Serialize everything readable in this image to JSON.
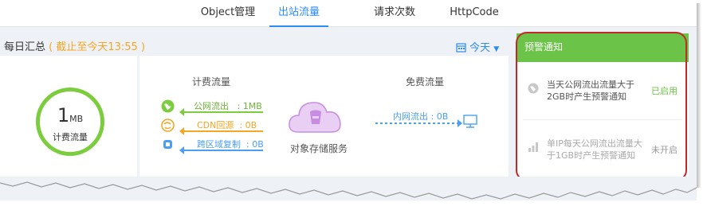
{
  "tabs": [
    {
      "label": "Object管理",
      "active": false
    },
    {
      "label": "出站流量",
      "active": true
    },
    {
      "label": "请求次数",
      "active": false
    },
    {
      "label": "HttpCode",
      "active": false
    }
  ],
  "summary": {
    "title": "每日汇总",
    "note": "( 截止至今天13:55 )",
    "date_select": "今天"
  },
  "total": {
    "value": "1",
    "unit": "MB",
    "label": "计费流量"
  },
  "billing": {
    "header": "计费流量",
    "rows": [
      {
        "label": "公网流出",
        "value": "1MB",
        "color": "#7ccd3e",
        "icon": "globe-icon"
      },
      {
        "label": "CDN回源",
        "value": "0B",
        "color": "#f5a623",
        "icon": "cdn-icon"
      },
      {
        "label": "跨区域复制",
        "value": "0B",
        "color": "#4a9ff5",
        "icon": "replication-icon"
      }
    ]
  },
  "free": {
    "header": "免费流量",
    "row": {
      "label": "内网流出",
      "value": "0B",
      "color": "#4a9ff5",
      "icon": "server-icon"
    }
  },
  "oss": {
    "label": "对象存储服务",
    "icon": "cloud-bucket-icon",
    "color": "#c88de0"
  },
  "alerts": {
    "title": "预警通知",
    "items": [
      {
        "text": "当天公网流出流量大于2GB时产生预警通知",
        "status": "已启用",
        "status_color": "#6bc447",
        "icon": "globe-icon"
      },
      {
        "text": "单IP每天公网流出流量大于1GB时产生预警通知",
        "status": "未开启",
        "status_color": "#999999",
        "icon": "bar-chart-icon"
      }
    ]
  }
}
